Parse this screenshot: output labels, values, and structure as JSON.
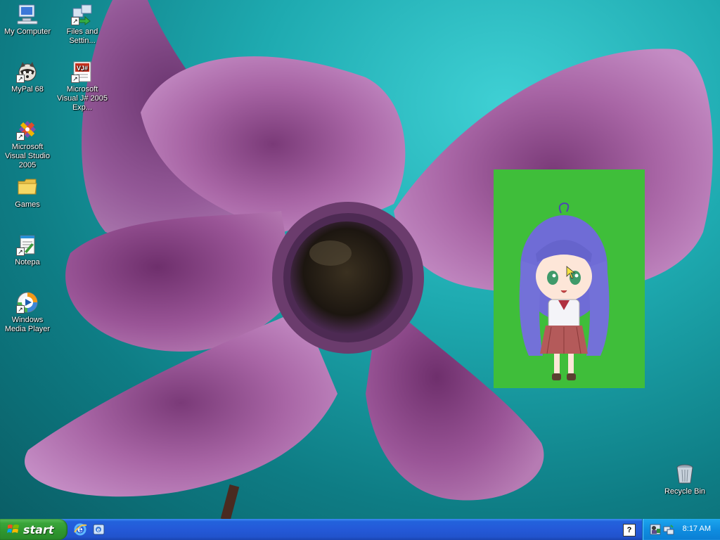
{
  "desktop": {
    "icons": [
      {
        "id": "my-computer",
        "label": "My Computer",
        "icon": "my-computer-icon"
      },
      {
        "id": "files-and-settings",
        "label": "Files and Settin...",
        "icon": "files-transfer-icon"
      },
      {
        "id": "mypal",
        "label": "MyPal 68",
        "icon": "mypal-raccoon-icon"
      },
      {
        "id": "visual-jsharp",
        "label": "Microsoft Visual J# 2005 Exp...",
        "icon": "visual-jsharp-icon"
      },
      {
        "id": "visual-studio",
        "label": "Microsoft Visual Studio 2005",
        "icon": "visual-studio-icon"
      },
      {
        "id": "games",
        "label": "Games",
        "icon": "folder-icon"
      },
      {
        "id": "notepad",
        "label": "Notepa",
        "icon": "notepad-icon"
      },
      {
        "id": "media-player",
        "label": "Windows Media Player",
        "icon": "media-player-icon"
      },
      {
        "id": "recycle-bin",
        "label": "Recycle Bin",
        "icon": "recycle-bin-icon"
      }
    ],
    "overlay": {
      "description_icon": "anime-mascot-image",
      "background": "#3fbe3a"
    }
  },
  "taskbar": {
    "start_label": "start",
    "quick_launch": [
      "internet-explorer-icon",
      "show-desktop-icon"
    ],
    "tray": {
      "help_label": "?",
      "icons": [
        "user-network-icon",
        "network-connection-icon"
      ],
      "clock": "8:17 AM"
    }
  }
}
